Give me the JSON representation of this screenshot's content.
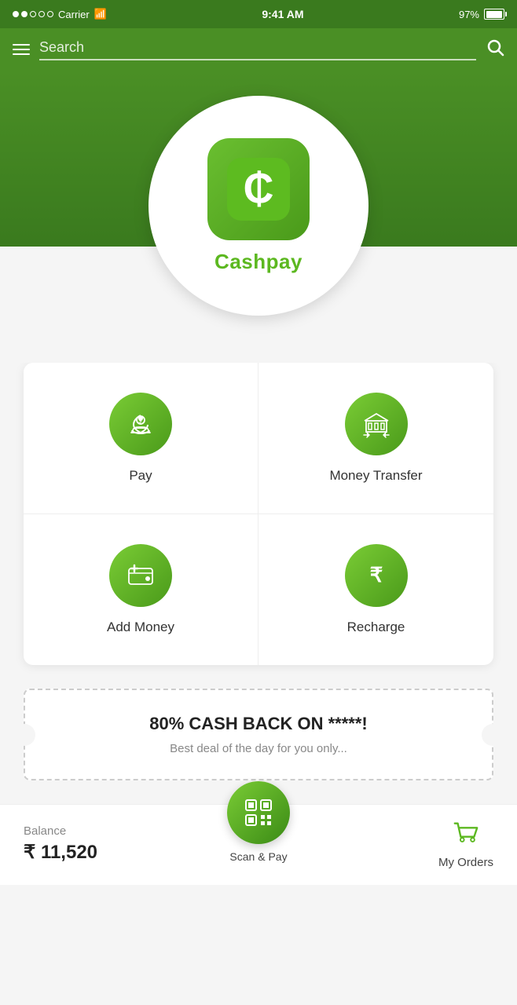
{
  "statusBar": {
    "carrier": "Carrier",
    "time": "9:41 AM",
    "battery": "97%"
  },
  "searchBar": {
    "placeholder": "Search"
  },
  "logo": {
    "name": "Cashpay"
  },
  "actions": [
    {
      "id": "pay",
      "label": "Pay",
      "icon": "pay"
    },
    {
      "id": "money-transfer",
      "label": "Money Transfer",
      "icon": "transfer"
    },
    {
      "id": "add-money",
      "label": "Add Money",
      "icon": "wallet"
    },
    {
      "id": "recharge",
      "label": "Recharge",
      "icon": "recharge"
    }
  ],
  "promo": {
    "title": "80% CASH BACK ON *****!",
    "subtitle": "Best deal of the day for you only..."
  },
  "bottomBar": {
    "balanceLabel": "Balance",
    "balanceAmount": "₹ 11,520",
    "scanLabel": "Scan & Pay",
    "ordersLabel": "My Orders"
  }
}
